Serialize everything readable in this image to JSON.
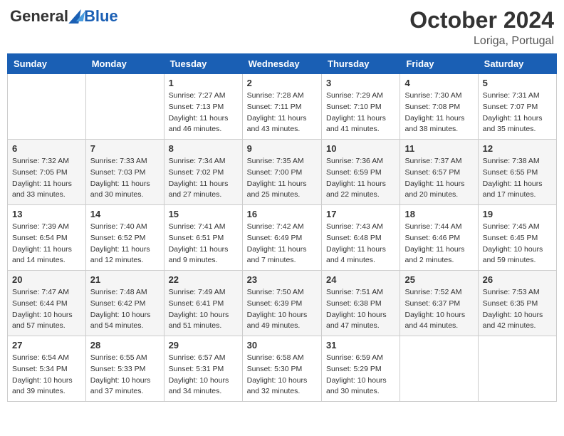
{
  "header": {
    "logo_general": "General",
    "logo_blue": "Blue",
    "month_title": "October 2024",
    "location": "Loriga, Portugal"
  },
  "weekdays": [
    "Sunday",
    "Monday",
    "Tuesday",
    "Wednesday",
    "Thursday",
    "Friday",
    "Saturday"
  ],
  "weeks": [
    [
      {
        "day": "",
        "info": ""
      },
      {
        "day": "",
        "info": ""
      },
      {
        "day": "1",
        "info": "Sunrise: 7:27 AM\nSunset: 7:13 PM\nDaylight: 11 hours and 46 minutes."
      },
      {
        "day": "2",
        "info": "Sunrise: 7:28 AM\nSunset: 7:11 PM\nDaylight: 11 hours and 43 minutes."
      },
      {
        "day": "3",
        "info": "Sunrise: 7:29 AM\nSunset: 7:10 PM\nDaylight: 11 hours and 41 minutes."
      },
      {
        "day": "4",
        "info": "Sunrise: 7:30 AM\nSunset: 7:08 PM\nDaylight: 11 hours and 38 minutes."
      },
      {
        "day": "5",
        "info": "Sunrise: 7:31 AM\nSunset: 7:07 PM\nDaylight: 11 hours and 35 minutes."
      }
    ],
    [
      {
        "day": "6",
        "info": "Sunrise: 7:32 AM\nSunset: 7:05 PM\nDaylight: 11 hours and 33 minutes."
      },
      {
        "day": "7",
        "info": "Sunrise: 7:33 AM\nSunset: 7:03 PM\nDaylight: 11 hours and 30 minutes."
      },
      {
        "day": "8",
        "info": "Sunrise: 7:34 AM\nSunset: 7:02 PM\nDaylight: 11 hours and 27 minutes."
      },
      {
        "day": "9",
        "info": "Sunrise: 7:35 AM\nSunset: 7:00 PM\nDaylight: 11 hours and 25 minutes."
      },
      {
        "day": "10",
        "info": "Sunrise: 7:36 AM\nSunset: 6:59 PM\nDaylight: 11 hours and 22 minutes."
      },
      {
        "day": "11",
        "info": "Sunrise: 7:37 AM\nSunset: 6:57 PM\nDaylight: 11 hours and 20 minutes."
      },
      {
        "day": "12",
        "info": "Sunrise: 7:38 AM\nSunset: 6:55 PM\nDaylight: 11 hours and 17 minutes."
      }
    ],
    [
      {
        "day": "13",
        "info": "Sunrise: 7:39 AM\nSunset: 6:54 PM\nDaylight: 11 hours and 14 minutes."
      },
      {
        "day": "14",
        "info": "Sunrise: 7:40 AM\nSunset: 6:52 PM\nDaylight: 11 hours and 12 minutes."
      },
      {
        "day": "15",
        "info": "Sunrise: 7:41 AM\nSunset: 6:51 PM\nDaylight: 11 hours and 9 minutes."
      },
      {
        "day": "16",
        "info": "Sunrise: 7:42 AM\nSunset: 6:49 PM\nDaylight: 11 hours and 7 minutes."
      },
      {
        "day": "17",
        "info": "Sunrise: 7:43 AM\nSunset: 6:48 PM\nDaylight: 11 hours and 4 minutes."
      },
      {
        "day": "18",
        "info": "Sunrise: 7:44 AM\nSunset: 6:46 PM\nDaylight: 11 hours and 2 minutes."
      },
      {
        "day": "19",
        "info": "Sunrise: 7:45 AM\nSunset: 6:45 PM\nDaylight: 10 hours and 59 minutes."
      }
    ],
    [
      {
        "day": "20",
        "info": "Sunrise: 7:47 AM\nSunset: 6:44 PM\nDaylight: 10 hours and 57 minutes."
      },
      {
        "day": "21",
        "info": "Sunrise: 7:48 AM\nSunset: 6:42 PM\nDaylight: 10 hours and 54 minutes."
      },
      {
        "day": "22",
        "info": "Sunrise: 7:49 AM\nSunset: 6:41 PM\nDaylight: 10 hours and 51 minutes."
      },
      {
        "day": "23",
        "info": "Sunrise: 7:50 AM\nSunset: 6:39 PM\nDaylight: 10 hours and 49 minutes."
      },
      {
        "day": "24",
        "info": "Sunrise: 7:51 AM\nSunset: 6:38 PM\nDaylight: 10 hours and 47 minutes."
      },
      {
        "day": "25",
        "info": "Sunrise: 7:52 AM\nSunset: 6:37 PM\nDaylight: 10 hours and 44 minutes."
      },
      {
        "day": "26",
        "info": "Sunrise: 7:53 AM\nSunset: 6:35 PM\nDaylight: 10 hours and 42 minutes."
      }
    ],
    [
      {
        "day": "27",
        "info": "Sunrise: 6:54 AM\nSunset: 5:34 PM\nDaylight: 10 hours and 39 minutes."
      },
      {
        "day": "28",
        "info": "Sunrise: 6:55 AM\nSunset: 5:33 PM\nDaylight: 10 hours and 37 minutes."
      },
      {
        "day": "29",
        "info": "Sunrise: 6:57 AM\nSunset: 5:31 PM\nDaylight: 10 hours and 34 minutes."
      },
      {
        "day": "30",
        "info": "Sunrise: 6:58 AM\nSunset: 5:30 PM\nDaylight: 10 hours and 32 minutes."
      },
      {
        "day": "31",
        "info": "Sunrise: 6:59 AM\nSunset: 5:29 PM\nDaylight: 10 hours and 30 minutes."
      },
      {
        "day": "",
        "info": ""
      },
      {
        "day": "",
        "info": ""
      }
    ]
  ]
}
